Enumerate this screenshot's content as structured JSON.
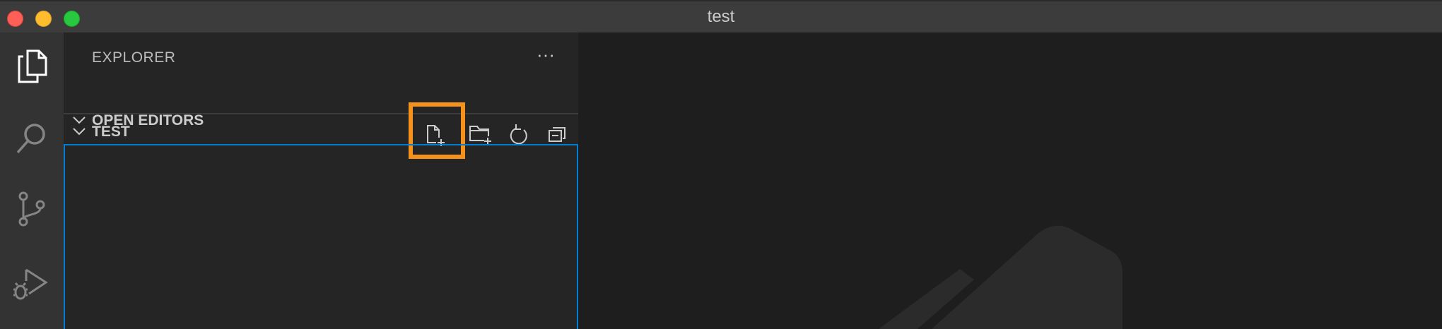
{
  "window": {
    "title": "test"
  },
  "explorer": {
    "title": "EXPLORER",
    "more_label": "···",
    "sections": [
      {
        "label": "OPEN EDITORS"
      },
      {
        "label": "TEST"
      }
    ]
  },
  "colors": {
    "highlight": "#f5921b",
    "focus_border": "#007fd4"
  },
  "icons": {
    "activity": [
      "explorer-icon",
      "search-icon",
      "source-control-icon",
      "run-debug-icon"
    ],
    "toolbar": [
      "new-file-icon",
      "new-folder-icon",
      "refresh-icon",
      "collapse-all-icon"
    ]
  }
}
